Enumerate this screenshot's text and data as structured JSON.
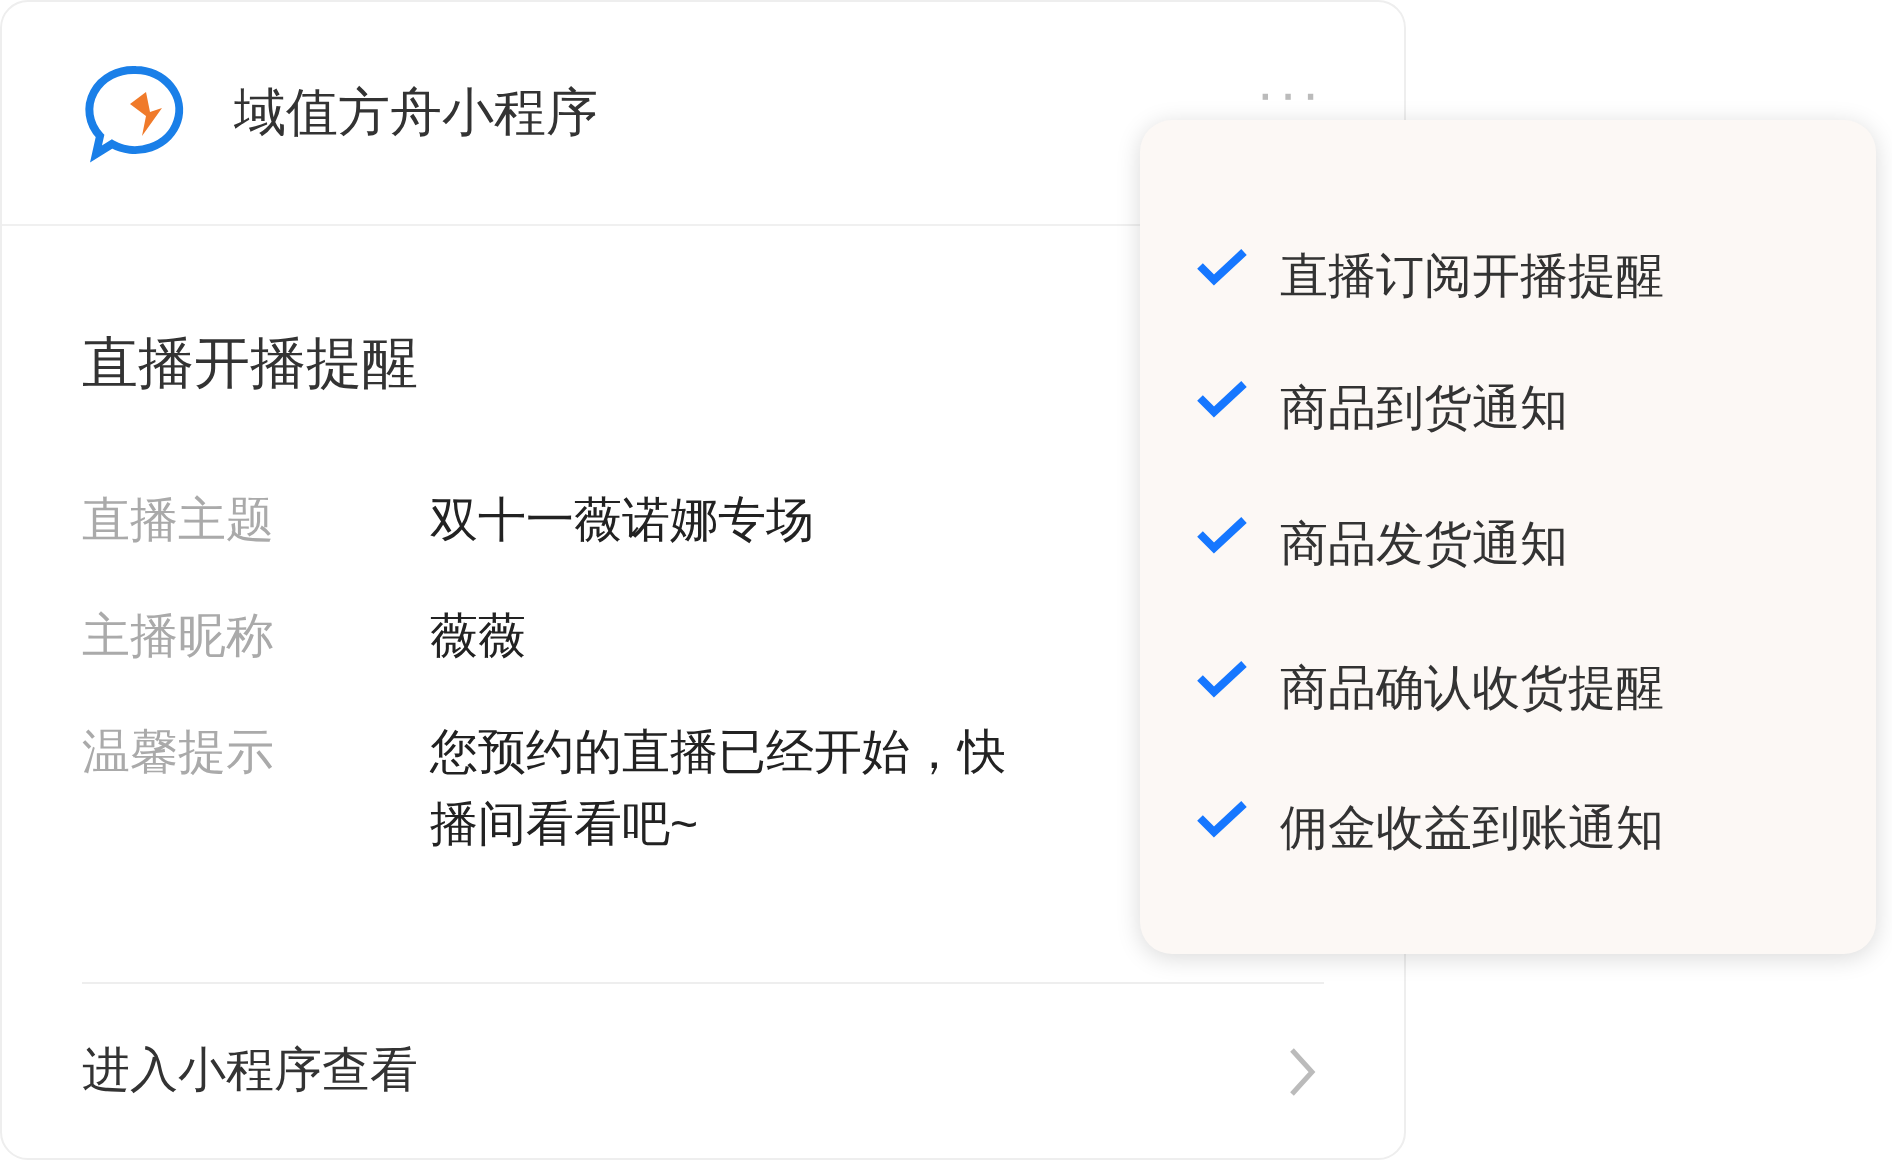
{
  "header": {
    "title": "域值方舟小程序",
    "more": "···"
  },
  "message": {
    "title": "直播开播提醒",
    "fields": [
      {
        "label": "直播主题",
        "lines": [
          "双十一薇诺娜专场"
        ]
      },
      {
        "label": "主播昵称",
        "lines": [
          "薇薇"
        ]
      },
      {
        "label": "温馨提示",
        "lines": [
          "您预约的直播已经开始，快",
          "播间看看吧~"
        ]
      }
    ]
  },
  "footer": {
    "label": "进入小程序查看"
  },
  "menu": {
    "items": [
      {
        "label": "直播订阅开播提醒",
        "checked": true
      },
      {
        "label": "商品到货通知",
        "checked": true
      },
      {
        "label": "商品发货通知",
        "checked": true
      },
      {
        "label": "商品确认收货提醒",
        "checked": true
      },
      {
        "label": "佣金收益到账通知",
        "checked": true
      }
    ]
  }
}
